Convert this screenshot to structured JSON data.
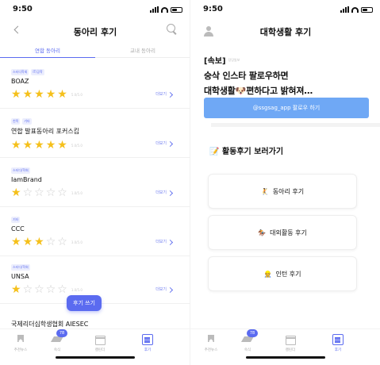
{
  "left": {
    "status": {
      "time": "9:50"
    },
    "header": {
      "title": "동아리 후기"
    },
    "tabs": [
      {
        "label": "연합 동아리",
        "active": true
      },
      {
        "label": "교내 동아리",
        "active": false
      }
    ],
    "clubs": [
      {
        "tags": [
          "스터디학회",
          "IT/공학"
        ],
        "name": "BOAZ",
        "rating": 5,
        "score": "5.0/5.0",
        "more": "더보기"
      },
      {
        "tags": [
          "친목",
          "기타"
        ],
        "name": "연합 발표동아리 포커스킵",
        "rating": 5,
        "score": "5.0/5.0",
        "more": "더보기"
      },
      {
        "tags": [
          "스터디/학회"
        ],
        "name": "IamBrand",
        "rating": 1,
        "score": "1.0/5.0",
        "more": "더보기"
      },
      {
        "tags": [
          "기타"
        ],
        "name": "CCC",
        "rating": 3,
        "score": "3.0/5.0",
        "more": "더보기"
      },
      {
        "tags": [
          "스터디/학회"
        ],
        "name": "UNSA",
        "rating": 1,
        "score": "1.0/5.0",
        "more": "더보기"
      }
    ],
    "partial_item": "국제리더십학생협회 AIESEC",
    "fab": "후기 쓰기",
    "nav": [
      {
        "label": "추천뉴스",
        "icon": "bookmark-icon"
      },
      {
        "label": "숙식",
        "icon": "graduation-cap-icon",
        "badge": "78"
      },
      {
        "label": "캘린더",
        "icon": "calendar-icon"
      },
      {
        "label": "후기",
        "icon": "document-icon",
        "active": true
      }
    ]
  },
  "right": {
    "status": {
      "time": "9:50"
    },
    "header": {
      "title": "대학생활 후기"
    },
    "headline": {
      "tag": "[속보]",
      "source": "덩덩일보",
      "line1": "숭삭 인스타 팔로우하면",
      "line2_a": "대학생활",
      "line2_emoji": "🐶",
      "line2_b": "편하다고 밝혀져…"
    },
    "follow_button": "@ssgsag_app 팔로우 하기",
    "section_title": "활동후기 보러가기",
    "section_emoji": "📝",
    "cards": [
      {
        "emoji": "🤾",
        "label": "동아리 후기"
      },
      {
        "emoji": "🏇",
        "label": "대외활동 후기"
      },
      {
        "emoji": "👷",
        "label": "인턴 후기"
      }
    ],
    "nav": [
      {
        "label": "추천뉴스",
        "icon": "bookmark-icon"
      },
      {
        "label": "숙식",
        "icon": "graduation-cap-icon",
        "badge": "78"
      },
      {
        "label": "캘린더",
        "icon": "calendar-icon"
      },
      {
        "label": "후기",
        "icon": "document-icon",
        "active": true
      }
    ]
  },
  "colors": {
    "accent": "#5b6bf0",
    "star": "#f5c01b",
    "follow": "#6fa8f5"
  }
}
